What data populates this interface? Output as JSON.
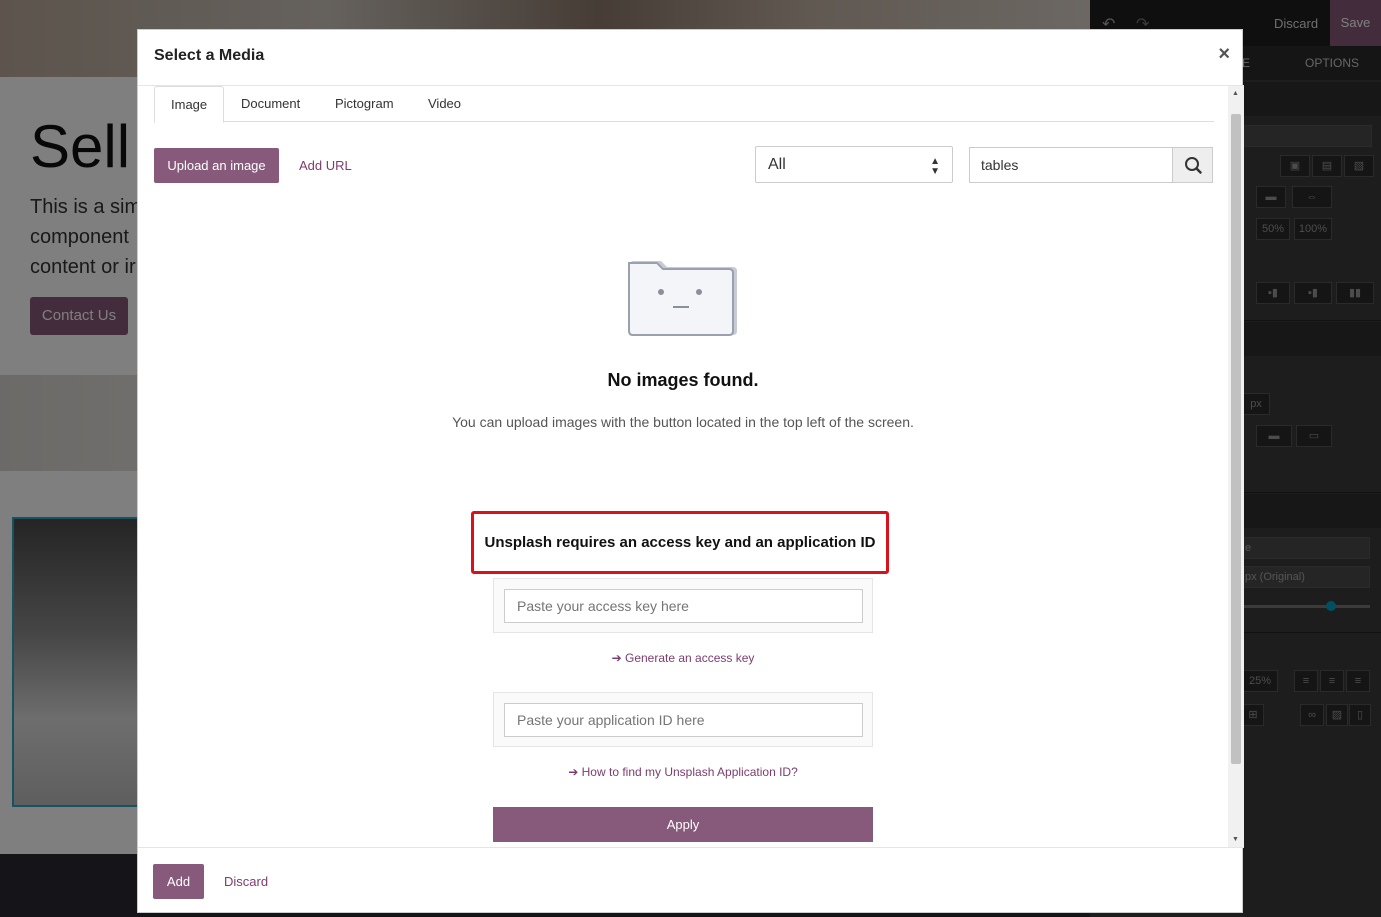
{
  "background_page": {
    "hero_title": "Sell",
    "hero_text_lines": [
      "This is a sim",
      "component",
      "content or ir"
    ],
    "contact_button": "Contact Us"
  },
  "editor": {
    "discard_label": "Discard",
    "save_label": "Save",
    "tab_style_fragment": "E",
    "tab_options": "OPTIONS",
    "size_50": "50%",
    "size_100": "100%",
    "unit_px": "px",
    "style_fragment": "e",
    "select_fragment": "e",
    "original_fragment": "px (Original)",
    "width_25": "25%",
    "accent_color": "#875a7b",
    "slider_color": "#00a0c6"
  },
  "modal": {
    "title": "Select a Media",
    "close_label": "×",
    "tabs": [
      {
        "label": "Image",
        "active": true
      },
      {
        "label": "Document",
        "active": false
      },
      {
        "label": "Pictogram",
        "active": false
      },
      {
        "label": "Video",
        "active": false
      }
    ],
    "upload_button": "Upload an image",
    "add_url_link": "Add URL",
    "filter_select": "All",
    "search_value": "tables",
    "empty_title": "No images found.",
    "empty_subtitle": "You can upload images with the button located in the top left of the screen.",
    "unsplash_title": "Unsplash requires an access key and an application ID",
    "access_key_placeholder": "Paste your access key here",
    "generate_key_link": "Generate an access key",
    "app_id_placeholder": "Paste your application ID here",
    "find_app_id_link": "How to find my Unsplash Application ID?",
    "apply_button": "Apply",
    "footer_add": "Add",
    "footer_discard": "Discard"
  },
  "colors": {
    "primary": "#875a7b",
    "link": "#7c3c6f",
    "highlight_border": "#d9111a"
  }
}
